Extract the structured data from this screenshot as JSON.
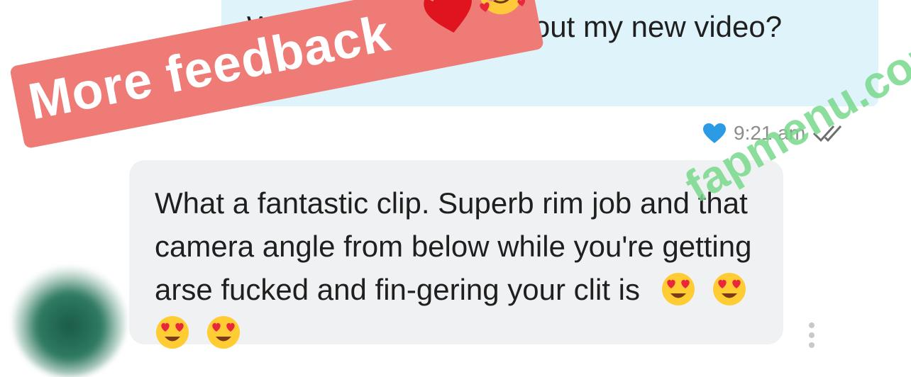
{
  "outgoing_message": {
    "text": "What did you think about my new video?",
    "time": "9:21 am",
    "status_icon": "double-check-icon",
    "reaction_icon": "blue-heart-icon"
  },
  "incoming_message": {
    "text": "What a fantastic clip. Superb rim job and that camera angle from below while you're getting arse fucked and fin-gering your clit is",
    "emoji_icons": [
      "heart-eyes-emoji",
      "heart-eyes-emoji",
      "heart-eyes-emoji",
      "heart-eyes-emoji"
    ]
  },
  "banner": {
    "text": "More feedback",
    "icons": [
      "red-heart-emoji",
      "smiling-face-with-hearts-emoji"
    ],
    "color": "#ee7b76"
  },
  "watermark": {
    "text": "fapmenu.com",
    "color": "#79d98c"
  },
  "colors": {
    "outgoing_bubble": "#dff3fb",
    "incoming_bubble": "#f0f1f2",
    "reaction_heart": "#2b9be6"
  }
}
